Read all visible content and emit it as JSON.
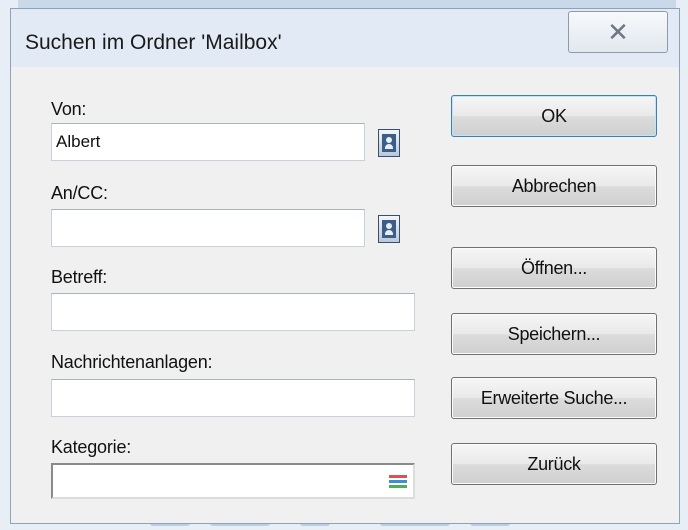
{
  "dialog": {
    "title": "Suchen im Ordner 'Mailbox'",
    "close_glyph": "✕"
  },
  "fields": {
    "von": {
      "label": "Von:",
      "value": "Albert"
    },
    "an_cc": {
      "label": "An/CC:",
      "value": ""
    },
    "betreff": {
      "label": "Betreff:",
      "value": ""
    },
    "anlagen": {
      "label": "Nachrichtenanlagen:",
      "value": ""
    },
    "kategorie": {
      "label": "Kategorie:",
      "value": ""
    }
  },
  "buttons": {
    "ok": "OK",
    "cancel": "Abbrechen",
    "open": "Öffnen...",
    "save": "Speichern...",
    "advanced": "Erweiterte Suche...",
    "back": "Zurück"
  },
  "icons": {
    "address_book": "address-book-icon",
    "category": "category-list-icon"
  },
  "colors": {
    "window_bg": "#f0f0f0",
    "titlebar_bg": "#e2ebf5",
    "accent": "#3c7fb1"
  }
}
